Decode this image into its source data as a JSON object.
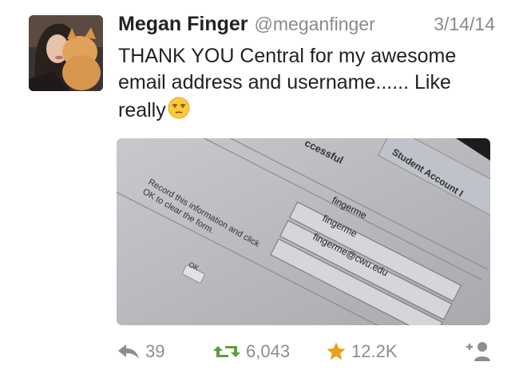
{
  "tweet": {
    "author_name": "Megan Finger",
    "handle": "@meganfinger",
    "date": "3/14/14",
    "text": "THANK YOU Central for my awesome email address and username...... Like really"
  },
  "media": {
    "header_label": "ccessful",
    "tab_label": "Student Account I",
    "instruction_line1": "Record this information and click",
    "instruction_line2": "OK to clear the form.",
    "ok_label": "OK",
    "field1": "fingerme",
    "field2": "fingerme",
    "field3": "fingerme@cwu.edu"
  },
  "actions": {
    "replies": "39",
    "retweets": "6,043",
    "favorites": "12.2K"
  },
  "colors": {
    "retweet_green": "#5c9e3a",
    "favorite_gold": "#e8a11b",
    "muted_gray": "#8d8d8d"
  },
  "icons": [
    "reply-icon",
    "retweet-icon",
    "favorite-star-icon",
    "follow-icon",
    "unamused-face-emoji"
  ]
}
